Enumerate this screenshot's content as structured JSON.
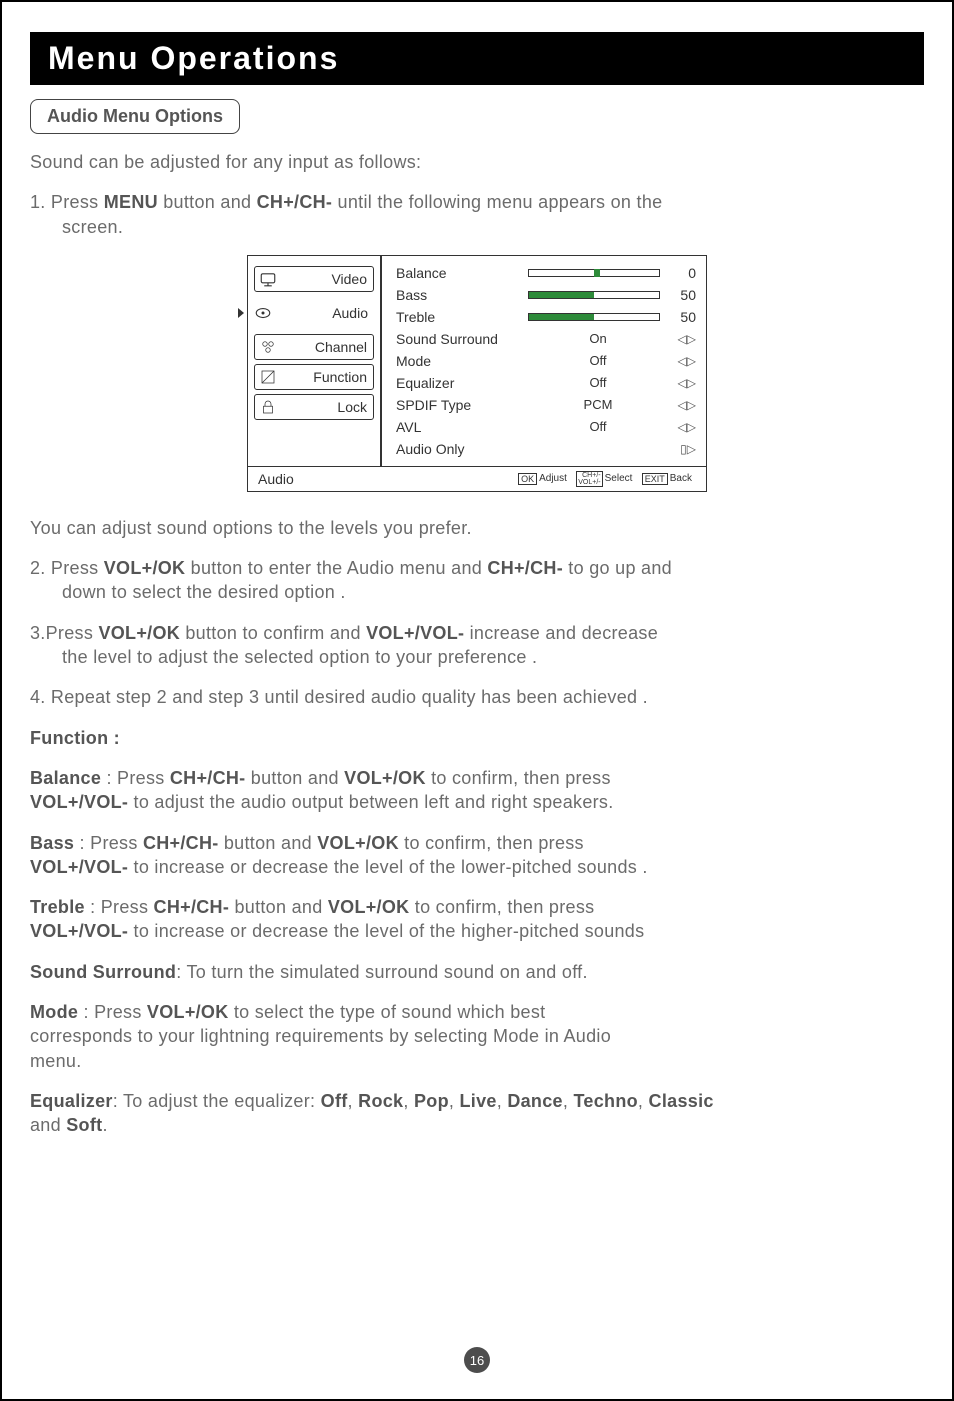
{
  "title": "Menu Operations",
  "section": "Audio Menu Options",
  "intro": "Sound can be adjusted for any input as follows:",
  "step1_pre": "1. Press ",
  "step1_menu": "MENU",
  "step1_mid": " button and ",
  "step1_ch": "CH+/CH-",
  "step1_post": " until the following menu appears on the",
  "step1_line2": "screen.",
  "osd": {
    "tabs": [
      "Video",
      "Audio",
      "Channel",
      "Function",
      "Lock"
    ],
    "footer_title": "Audio",
    "hints": {
      "ok": "OK",
      "adj": "Adjust",
      "stack_top": "CH+/-",
      "stack_bot": "VOL+/-",
      "sel": "Select",
      "exit": "EXIT",
      "back": "Back"
    },
    "rows": [
      {
        "name": "Balance",
        "type": "slider_center",
        "value": "0",
        "thumb": 50
      },
      {
        "name": "Bass",
        "type": "slider_fill",
        "value": "50",
        "fill": 50
      },
      {
        "name": "Treble",
        "type": "slider_fill",
        "value": "50",
        "fill": 50
      },
      {
        "name": "Sound Surround",
        "type": "lr",
        "value": "On"
      },
      {
        "name": "Mode",
        "type": "lr",
        "value": "Off"
      },
      {
        "name": "Equalizer",
        "type": "lr",
        "value": "Off"
      },
      {
        "name": "SPDIF Type",
        "type": "lr",
        "value": "PCM"
      },
      {
        "name": "AVL",
        "type": "lr",
        "value": "Off"
      },
      {
        "name": "Audio Only",
        "type": "enter",
        "value": ""
      }
    ]
  },
  "after_osd": "You can adjust sound options  to the levels you prefer.",
  "step2_a": "2. Press ",
  "step2_b": "VOL+/OK",
  "step2_c": " button to enter the Audio  menu and ",
  "step2_d": "CH+/CH-",
  "step2_e": " to go up and",
  "step2_line2": "down to select the desired option .",
  "step3_a": "3.Press ",
  "step3_b": "VOL+/OK",
  "step3_c": " button to confirm and ",
  "step3_d": "VOL+/VOL-",
  "step3_e": " increase and decrease",
  "step3_line2": "the level to adjust the selected option to your preference .",
  "step4": "4. Repeat step 2 and step 3 until desired audio quality has been achieved .",
  "func_head": "Function :",
  "balance_a": "Balance",
  "balance_b": " :  Press ",
  "balance_c": "CH+/CH-",
  "balance_d": " button and ",
  "balance_e": "VOL+/OK",
  "balance_f": " to confirm, then press",
  "balance_g": "VOL+/VOL-",
  "balance_h": " to adjust the audio output between left and right speakers.",
  "bass_a": "Bass",
  "bass_b": " : Press ",
  "bass_c": "CH+/CH-",
  "bass_d": " button and ",
  "bass_e": "VOL+/OK",
  "bass_f": " to confirm, then press",
  "bass_g": "VOL+/VOL-",
  "bass_h": " to increase or decrease the level of the lower-pitched sounds .",
  "treble_a": "Treble",
  "treble_b": " : Press ",
  "treble_c": "CH+/CH-",
  "treble_d": " button and ",
  "treble_e": "VOL+/OK",
  "treble_f": " to confirm, then press",
  "treble_g": "VOL+/VOL-",
  "treble_h": " to increase or decrease the level of the higher-pitched sounds",
  "ss_a": "Sound Surround",
  "ss_b": ": To turn the simulated surround sound on and off.",
  "mode_a": "Mode",
  "mode_b": " : Press ",
  "mode_c": "VOL+/OK",
  "mode_d": " to select the type of sound which best",
  "mode_e": "corresponds to your lightning requirements by selecting Mode in Audio",
  "mode_f": "menu.",
  "eq_a": "Equalizer",
  "eq_b": ": To adjust the equalizer: ",
  "eq_vals": [
    "Off",
    "Rock",
    "Pop",
    "Live",
    "Dance",
    "Techno",
    "Classic"
  ],
  "eq_and": "and ",
  "eq_last": "Soft",
  "eq_dot": ".",
  "pagenum": "16"
}
